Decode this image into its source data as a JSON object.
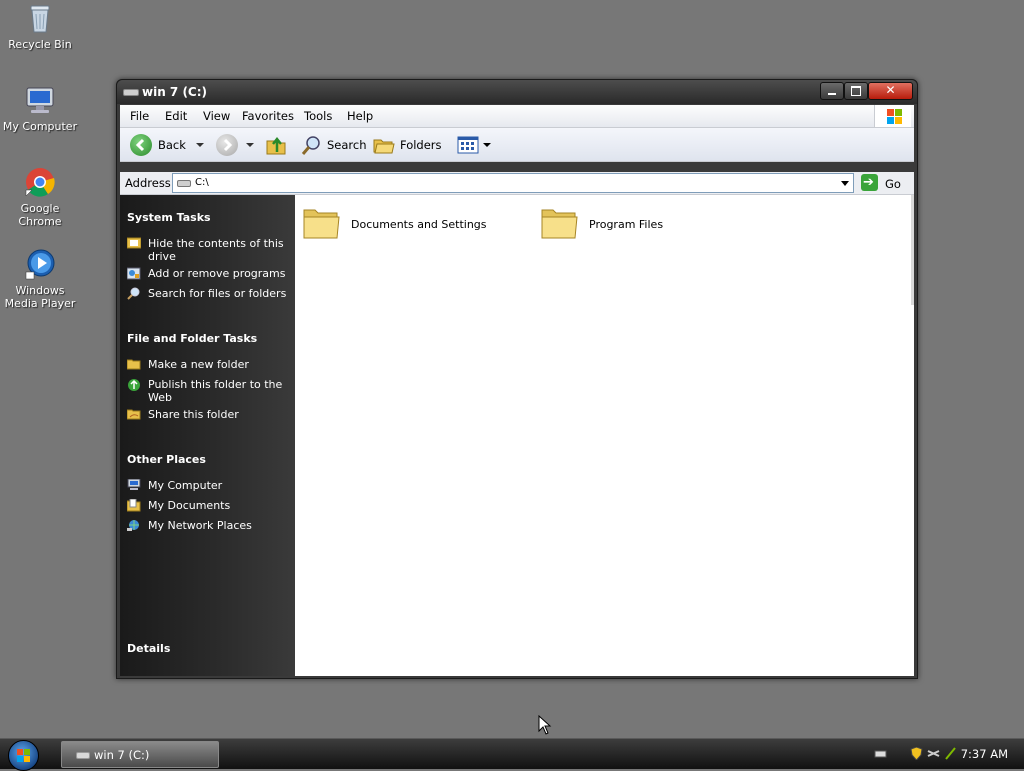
{
  "desktop": {
    "icons": [
      {
        "label": "Recycle Bin",
        "icon": "recycle-bin-icon"
      },
      {
        "label": "My Computer",
        "icon": "computer-icon"
      },
      {
        "label": "Google Chrome",
        "icon": "chrome-icon"
      },
      {
        "label": "Windows Media Player",
        "icon": "media-player-icon"
      }
    ]
  },
  "window": {
    "title": "win 7 (C:)",
    "menu": [
      "File",
      "Edit",
      "View",
      "Favorites",
      "Tools",
      "Help"
    ],
    "toolbar": {
      "back": "Back",
      "search": "Search",
      "folders": "Folders"
    },
    "address": {
      "label": "Address",
      "value": "C:\\",
      "go": "Go"
    },
    "task_pane": {
      "system_tasks": {
        "title": "System Tasks",
        "items": [
          "Hide the contents of this drive",
          "Add or remove programs",
          "Search for files or folders"
        ]
      },
      "file_folder_tasks": {
        "title": "File and Folder Tasks",
        "items": [
          "Make a new folder",
          "Publish this folder to the Web",
          "Share this folder"
        ]
      },
      "other_places": {
        "title": "Other Places",
        "items": [
          "My Computer",
          "My Documents",
          "My Network Places"
        ]
      },
      "details": {
        "title": "Details"
      }
    },
    "files": [
      {
        "name": "Documents and Settings",
        "type": "folder"
      },
      {
        "name": "Program Files",
        "type": "folder"
      }
    ]
  },
  "taskbar": {
    "task_label": "win 7 (C:)",
    "clock": "7:37 AM"
  },
  "colors": {
    "desktop": "#777777",
    "task_pane": "#2a2a2a",
    "folder": "#f2d56b",
    "back_button": "#3aa43a",
    "close_button": "#c8321e"
  }
}
